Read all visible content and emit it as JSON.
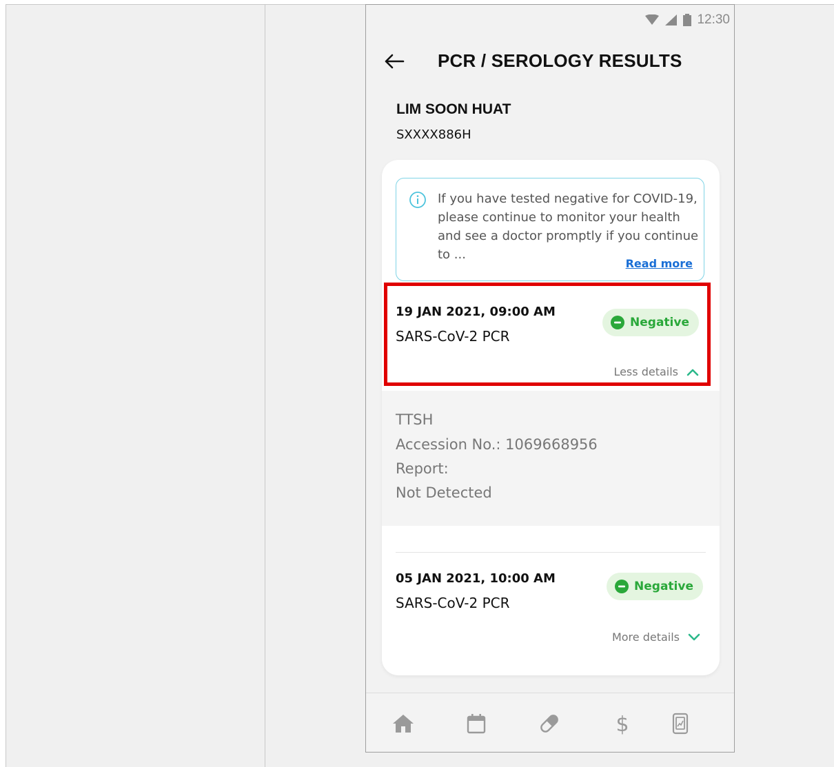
{
  "status_bar": {
    "time": "12:30"
  },
  "header": {
    "title": "PCR / SEROLOGY RESULTS"
  },
  "patient": {
    "name": "LIM SOON HUAT",
    "id": "SXXXX886H"
  },
  "notice": {
    "text": "If you have tested negative for COVID-19, please continue to monitor your health and see a doctor promptly if you continue to ...",
    "read_more": "Read more"
  },
  "results": [
    {
      "datetime": "19 JAN 2021, 09:00 AM",
      "test": "SARS-CoV-2 PCR",
      "status": "Negative",
      "toggle_label": "Less details",
      "expanded": true,
      "details": {
        "lab": "TTSH",
        "accession": "Accession No.: 1069668956",
        "report_label": "Report:",
        "report_value": "Not Detected"
      }
    },
    {
      "datetime": "05 JAN 2021, 10:00 AM",
      "test": "SARS-CoV-2 PCR",
      "status": "Negative",
      "toggle_label": "More details",
      "expanded": false
    }
  ],
  "bottom_nav": [
    {
      "icon": "home-icon"
    },
    {
      "icon": "calendar-icon"
    },
    {
      "icon": "pill-icon"
    },
    {
      "icon": "dollar-icon"
    },
    {
      "icon": "report-icon"
    }
  ],
  "colors": {
    "negative_text": "#2aa83a",
    "negative_bg": "#e4f5e0",
    "link": "#1a6fd6",
    "info_border": "#7fd4e6",
    "chevron": "#2bb88a",
    "highlight": "#e00000"
  }
}
